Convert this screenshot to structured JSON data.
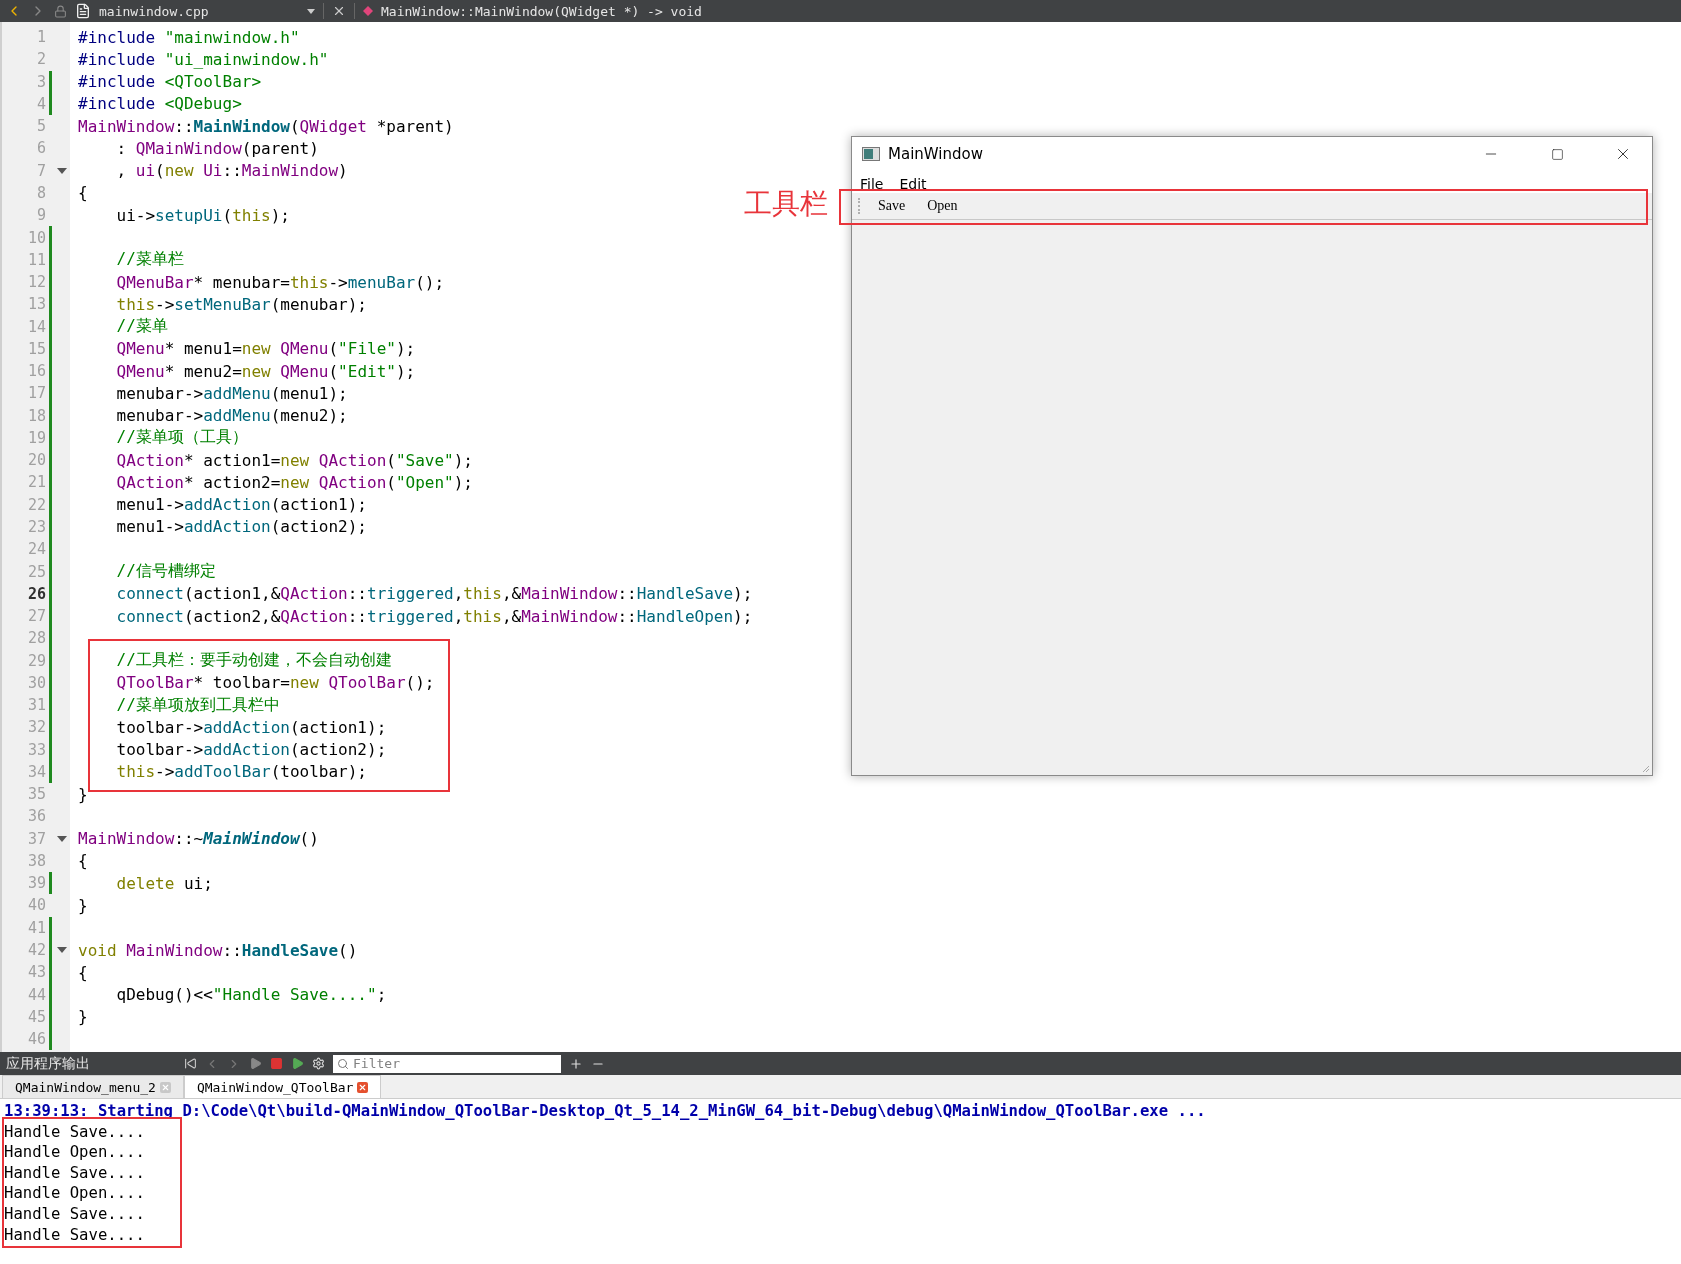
{
  "editor_bar": {
    "file": "mainwindow.cpp",
    "symbol": "MainWindow::MainWindow(QWidget *) -> void"
  },
  "code_sections": [
    {
      "boxed": false,
      "lines": [
        {
          "number": "1",
          "modified": false,
          "fold": false,
          "current": false,
          "tokens": [
            {
              "kind": "pre",
              "text": "#include "
            },
            {
              "kind": "str",
              "text": "\"mainwindow.h\""
            }
          ]
        },
        {
          "number": "2",
          "modified": false,
          "fold": false,
          "current": false,
          "tokens": [
            {
              "kind": "pre",
              "text": "#include "
            },
            {
              "kind": "str",
              "text": "\"ui_mainwindow.h\""
            }
          ]
        },
        {
          "number": "3",
          "modified": true,
          "fold": false,
          "current": false,
          "tokens": [
            {
              "kind": "pre",
              "text": "#include "
            },
            {
              "kind": "str",
              "text": "<QToolBar>"
            }
          ]
        },
        {
          "number": "4",
          "modified": true,
          "fold": false,
          "current": false,
          "tokens": [
            {
              "kind": "pre",
              "text": "#include "
            },
            {
              "kind": "str",
              "text": "<QDebug>"
            }
          ]
        },
        {
          "number": "5",
          "modified": false,
          "fold": false,
          "current": false,
          "tokens": [
            {
              "kind": "type",
              "text": "MainWindow"
            },
            {
              "kind": "txt",
              "text": "::"
            },
            {
              "kind": "fndef",
              "text": "MainWindow"
            },
            {
              "kind": "txt",
              "text": "("
            },
            {
              "kind": "type",
              "text": "QWidget"
            },
            {
              "kind": "txt",
              "text": " *parent)"
            }
          ]
        },
        {
          "number": "6",
          "modified": false,
          "fold": false,
          "current": false,
          "tokens": [
            {
              "kind": "txt",
              "text": "    : "
            },
            {
              "kind": "type",
              "text": "QMainWindow"
            },
            {
              "kind": "txt",
              "text": "(parent)"
            }
          ]
        },
        {
          "number": "7",
          "modified": false,
          "fold": true,
          "current": false,
          "tokens": [
            {
              "kind": "txt",
              "text": "    , "
            },
            {
              "kind": "type",
              "text": "ui"
            },
            {
              "kind": "txt",
              "text": "("
            },
            {
              "kind": "kw",
              "text": "new "
            },
            {
              "kind": "type",
              "text": "Ui"
            },
            {
              "kind": "txt",
              "text": "::"
            },
            {
              "kind": "type",
              "text": "MainWindow"
            },
            {
              "kind": "txt",
              "text": ")"
            }
          ]
        },
        {
          "number": "8",
          "modified": false,
          "fold": false,
          "current": false,
          "tokens": [
            {
              "kind": "txt",
              "text": "{"
            }
          ]
        },
        {
          "number": "9",
          "modified": false,
          "fold": false,
          "current": false,
          "tokens": [
            {
              "kind": "txt",
              "text": "    ui->"
            },
            {
              "kind": "fn",
              "text": "setupUi"
            },
            {
              "kind": "txt",
              "text": "("
            },
            {
              "kind": "kw",
              "text": "this"
            },
            {
              "kind": "txt",
              "text": ");"
            }
          ]
        },
        {
          "number": "10",
          "modified": true,
          "fold": false,
          "current": false
        },
        {
          "number": "11",
          "modified": true,
          "fold": false,
          "current": false,
          "tokens": [
            {
              "kind": "cmt",
              "text": "    //菜单栏"
            }
          ]
        },
        {
          "number": "12",
          "modified": true,
          "fold": false,
          "current": false,
          "tokens": [
            {
              "kind": "type",
              "text": "    QMenuBar"
            },
            {
              "kind": "txt",
              "text": "* menubar="
            },
            {
              "kind": "kw",
              "text": "this"
            },
            {
              "kind": "txt",
              "text": "->"
            },
            {
              "kind": "fn",
              "text": "menuBar"
            },
            {
              "kind": "txt",
              "text": "();"
            }
          ]
        },
        {
          "number": "13",
          "modified": true,
          "fold": false,
          "current": false,
          "tokens": [
            {
              "kind": "kw",
              "text": "    this"
            },
            {
              "kind": "txt",
              "text": "->"
            },
            {
              "kind": "fn",
              "text": "setMenuBar"
            },
            {
              "kind": "txt",
              "text": "(menubar);"
            }
          ]
        },
        {
          "number": "14",
          "modified": true,
          "fold": false,
          "current": false,
          "tokens": [
            {
              "kind": "cmt",
              "text": "    //菜单"
            }
          ]
        },
        {
          "number": "15",
          "modified": true,
          "fold": false,
          "current": false,
          "tokens": [
            {
              "kind": "type",
              "text": "    QMenu"
            },
            {
              "kind": "txt",
              "text": "* menu1="
            },
            {
              "kind": "kw",
              "text": "new "
            },
            {
              "kind": "type",
              "text": "QMenu"
            },
            {
              "kind": "txt",
              "text": "("
            },
            {
              "kind": "str",
              "text": "\"File\""
            },
            {
              "kind": "txt",
              "text": ");"
            }
          ]
        },
        {
          "number": "16",
          "modified": true,
          "fold": false,
          "current": false,
          "tokens": [
            {
              "kind": "type",
              "text": "    QMenu"
            },
            {
              "kind": "txt",
              "text": "* menu2="
            },
            {
              "kind": "kw",
              "text": "new "
            },
            {
              "kind": "type",
              "text": "QMenu"
            },
            {
              "kind": "txt",
              "text": "("
            },
            {
              "kind": "str",
              "text": "\"Edit\""
            },
            {
              "kind": "txt",
              "text": ");"
            }
          ]
        },
        {
          "number": "17",
          "modified": true,
          "fold": false,
          "current": false,
          "tokens": [
            {
              "kind": "txt",
              "text": "    menubar->"
            },
            {
              "kind": "fn",
              "text": "addMenu"
            },
            {
              "kind": "txt",
              "text": "(menu1);"
            }
          ]
        },
        {
          "number": "18",
          "modified": true,
          "fold": false,
          "current": false,
          "tokens": [
            {
              "kind": "txt",
              "text": "    menubar->"
            },
            {
              "kind": "fn",
              "text": "addMenu"
            },
            {
              "kind": "txt",
              "text": "(menu2);"
            }
          ]
        },
        {
          "number": "19",
          "modified": true,
          "fold": false,
          "current": false,
          "tokens": [
            {
              "kind": "cmt",
              "text": "    //菜单项（工具）"
            }
          ]
        },
        {
          "number": "20",
          "modified": true,
          "fold": false,
          "current": false,
          "tokens": [
            {
              "kind": "type",
              "text": "    QAction"
            },
            {
              "kind": "txt",
              "text": "* action1="
            },
            {
              "kind": "kw",
              "text": "new "
            },
            {
              "kind": "type",
              "text": "QAction"
            },
            {
              "kind": "txt",
              "text": "("
            },
            {
              "kind": "str",
              "text": "\"Save\""
            },
            {
              "kind": "txt",
              "text": ");"
            }
          ]
        },
        {
          "number": "21",
          "modified": true,
          "fold": false,
          "current": false,
          "tokens": [
            {
              "kind": "type",
              "text": "    QAction"
            },
            {
              "kind": "txt",
              "text": "* action2="
            },
            {
              "kind": "kw",
              "text": "new "
            },
            {
              "kind": "type",
              "text": "QAction"
            },
            {
              "kind": "txt",
              "text": "("
            },
            {
              "kind": "str",
              "text": "\"Open\""
            },
            {
              "kind": "txt",
              "text": ");"
            }
          ]
        },
        {
          "number": "22",
          "modified": true,
          "fold": false,
          "current": false,
          "tokens": [
            {
              "kind": "txt",
              "text": "    menu1->"
            },
            {
              "kind": "fn",
              "text": "addAction"
            },
            {
              "kind": "txt",
              "text": "(action1);"
            }
          ]
        },
        {
          "number": "23",
          "modified": true,
          "fold": false,
          "current": false,
          "tokens": [
            {
              "kind": "txt",
              "text": "    menu1->"
            },
            {
              "kind": "fn",
              "text": "addAction"
            },
            {
              "kind": "txt",
              "text": "(action2);"
            }
          ]
        },
        {
          "number": "24",
          "modified": true,
          "fold": false,
          "current": false
        },
        {
          "number": "25",
          "modified": true,
          "fold": false,
          "current": false,
          "tokens": [
            {
              "kind": "cmt",
              "text": "    //信号槽绑定"
            }
          ]
        },
        {
          "number": "26",
          "modified": true,
          "fold": false,
          "current": true,
          "tokens": [
            {
              "kind": "fn",
              "text": "    connect"
            },
            {
              "kind": "txt",
              "text": "(action1,&"
            },
            {
              "kind": "type",
              "text": "QAction"
            },
            {
              "kind": "txt",
              "text": "::"
            },
            {
              "kind": "fn",
              "text": "triggered"
            },
            {
              "kind": "txt",
              "text": ","
            },
            {
              "kind": "kw",
              "text": "this"
            },
            {
              "kind": "txt",
              "text": ",&"
            },
            {
              "kind": "type",
              "text": "MainWindow"
            },
            {
              "kind": "txt",
              "text": "::"
            },
            {
              "kind": "fn",
              "text": "HandleSave"
            },
            {
              "kind": "txt",
              "text": ");"
            }
          ]
        },
        {
          "number": "27",
          "modified": true,
          "fold": false,
          "current": false,
          "tokens": [
            {
              "kind": "fn",
              "text": "    connect"
            },
            {
              "kind": "txt",
              "text": "(action2,&"
            },
            {
              "kind": "type",
              "text": "QAction"
            },
            {
              "kind": "txt",
              "text": "::"
            },
            {
              "kind": "fn",
              "text": "triggered"
            },
            {
              "kind": "txt",
              "text": ","
            },
            {
              "kind": "kw",
              "text": "this"
            },
            {
              "kind": "txt",
              "text": ",&"
            },
            {
              "kind": "type",
              "text": "MainWindow"
            },
            {
              "kind": "txt",
              "text": "::"
            },
            {
              "kind": "fn",
              "text": "HandleOpen"
            },
            {
              "kind": "txt",
              "text": ");"
            }
          ]
        },
        {
          "number": "28",
          "modified": true,
          "fold": false,
          "current": false
        }
      ]
    },
    {
      "boxed": true,
      "lines": [
        {
          "number": "29",
          "modified": true,
          "fold": false,
          "current": false,
          "tokens": [
            {
              "kind": "cmt",
              "text": "    //工具栏：要手动创建，不会自动创建"
            }
          ]
        },
        {
          "number": "30",
          "modified": true,
          "fold": false,
          "current": false,
          "tokens": [
            {
              "kind": "type",
              "text": "    QToolBar"
            },
            {
              "kind": "txt",
              "text": "* toolbar="
            },
            {
              "kind": "kw",
              "text": "new "
            },
            {
              "kind": "type",
              "text": "QToolBar"
            },
            {
              "kind": "txt",
              "text": "();"
            }
          ]
        },
        {
          "number": "31",
          "modified": true,
          "fold": false,
          "current": false,
          "tokens": [
            {
              "kind": "cmt",
              "text": "    //菜单项放到工具栏中"
            }
          ]
        },
        {
          "number": "32",
          "modified": true,
          "fold": false,
          "current": false,
          "tokens": [
            {
              "kind": "txt",
              "text": "    toolbar->"
            },
            {
              "kind": "fn",
              "text": "addAction"
            },
            {
              "kind": "txt",
              "text": "(action1);"
            }
          ]
        },
        {
          "number": "33",
          "modified": true,
          "fold": false,
          "current": false,
          "tokens": [
            {
              "kind": "txt",
              "text": "    toolbar->"
            },
            {
              "kind": "fn",
              "text": "addAction"
            },
            {
              "kind": "txt",
              "text": "(action2);"
            }
          ]
        },
        {
          "number": "34",
          "modified": true,
          "fold": false,
          "current": false,
          "tokens": [
            {
              "kind": "kw",
              "text": "    this"
            },
            {
              "kind": "txt",
              "text": "->"
            },
            {
              "kind": "fn",
              "text": "addToolBar"
            },
            {
              "kind": "txt",
              "text": "(toolbar);"
            }
          ]
        }
      ]
    },
    {
      "boxed": false,
      "lines": [
        {
          "number": "35",
          "modified": false,
          "fold": false,
          "current": false,
          "tokens": [
            {
              "kind": "txt",
              "text": "}"
            }
          ]
        },
        {
          "number": "36",
          "modified": false,
          "fold": false,
          "current": false
        },
        {
          "number": "37",
          "modified": false,
          "fold": true,
          "current": false,
          "tokens": [
            {
              "kind": "type",
              "text": "MainWindow"
            },
            {
              "kind": "txt",
              "text": "::~"
            },
            {
              "kind": "fnital",
              "text": "MainWindow"
            },
            {
              "kind": "txt",
              "text": "()"
            }
          ]
        },
        {
          "number": "38",
          "modified": false,
          "fold": false,
          "current": false,
          "tokens": [
            {
              "kind": "txt",
              "text": "{"
            }
          ]
        },
        {
          "number": "39",
          "modified": true,
          "fold": false,
          "current": false,
          "tokens": [
            {
              "kind": "kw",
              "text": "    delete"
            },
            {
              "kind": "txt",
              "text": " ui;"
            }
          ]
        },
        {
          "number": "40",
          "modified": false,
          "fold": false,
          "current": false,
          "tokens": [
            {
              "kind": "txt",
              "text": "}"
            }
          ]
        },
        {
          "number": "41",
          "modified": true,
          "fold": false,
          "current": false
        },
        {
          "number": "42",
          "modified": true,
          "fold": true,
          "current": false,
          "tokens": [
            {
              "kind": "kw",
              "text": "void "
            },
            {
              "kind": "type",
              "text": "MainWindow"
            },
            {
              "kind": "txt",
              "text": "::"
            },
            {
              "kind": "fndef",
              "text": "HandleSave"
            },
            {
              "kind": "txt",
              "text": "()"
            }
          ]
        },
        {
          "number": "43",
          "modified": true,
          "fold": false,
          "current": false,
          "tokens": [
            {
              "kind": "txt",
              "text": "{"
            }
          ]
        },
        {
          "number": "44",
          "modified": true,
          "fold": false,
          "current": false,
          "tokens": [
            {
              "kind": "txt",
              "text": "    qDebug()<<"
            },
            {
              "kind": "str",
              "text": "\"Handle Save....\""
            },
            {
              "kind": "txt",
              "text": ";"
            }
          ]
        },
        {
          "number": "45",
          "modified": true,
          "fold": false,
          "current": false,
          "tokens": [
            {
              "kind": "txt",
              "text": "}"
            }
          ]
        },
        {
          "number": "46",
          "modified": true,
          "fold": false,
          "current": false
        }
      ]
    }
  ],
  "app_window": {
    "title": "MainWindow",
    "menus": [
      "File",
      "Edit"
    ],
    "toolbar": {
      "boxed": true,
      "label": "工具栏",
      "actions": [
        "Save",
        "Open"
      ]
    }
  },
  "output_panel": {
    "title": "应用程序输出",
    "filter_placeholder": "Filter",
    "tabs": [
      {
        "label": "QMainWindow_menu_2",
        "selected": false
      },
      {
        "label": "QMainWindow_QToolBar",
        "selected": true
      }
    ],
    "sections": [
      {
        "boxed": false,
        "lines": [
          {
            "kind": "status",
            "text": "13:39:13: Starting D:\\Code\\Qt\\build-QMainWindow_QToolBar-Desktop_Qt_5_14_2_MinGW_64_bit-Debug\\debug\\QMainWindow_QToolBar.exe ..."
          }
        ]
      },
      {
        "boxed": true,
        "lines": [
          {
            "kind": "output",
            "text": "Handle Save...."
          },
          {
            "kind": "output",
            "text": "Handle Open...."
          },
          {
            "kind": "output",
            "text": "Handle Save...."
          },
          {
            "kind": "output",
            "text": "Handle Open...."
          },
          {
            "kind": "output",
            "text": "Handle Save...."
          },
          {
            "kind": "output",
            "text": "Handle Save...."
          }
        ]
      }
    ]
  }
}
